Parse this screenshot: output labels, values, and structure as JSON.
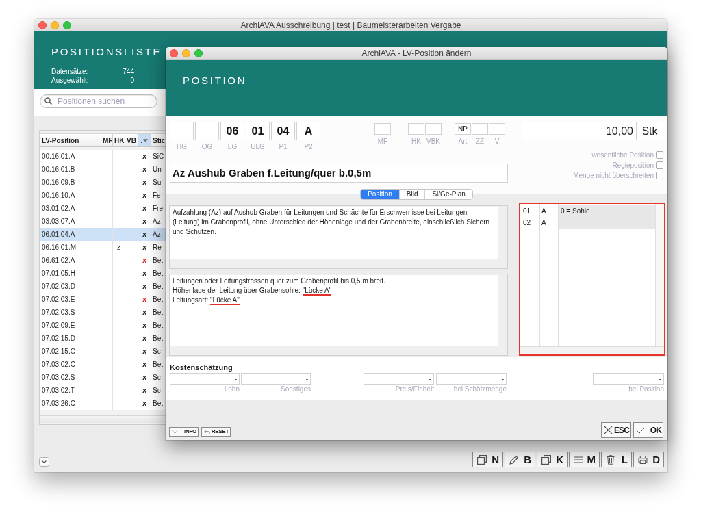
{
  "back_window": {
    "title": "ArchiAVA Ausschreibung | test | Baumeisterarbeiten Vergabe",
    "heading": "POSITIONSLISTE",
    "stats": [
      {
        "label": "Datensätze:",
        "value": "744"
      },
      {
        "label": "Ausgewählt:",
        "value": "0"
      }
    ],
    "search": {
      "placeholder": "Positionen suchen"
    },
    "table": {
      "columns": [
        {
          "label": "LV-Position",
          "sorted": false
        },
        {
          "label": "MF",
          "sorted": false
        },
        {
          "label": "HK",
          "sorted": false
        },
        {
          "label": "VB",
          "sorted": false
        },
        {
          "label": ".",
          "sorted": true
        },
        {
          "label": "Stic",
          "sorted": false
        }
      ],
      "rows": [
        {
          "position": "00.16.01.A",
          "column_5": "x",
          "color": "#1e1e1e",
          "column_6": "SiC",
          "selected": false
        },
        {
          "position": "00.16.01.B",
          "column_5": "x",
          "color": "#1e1e1e",
          "column_6": "Un",
          "selected": false
        },
        {
          "position": "00.16.09.B",
          "column_5": "x",
          "color": "#1e1e1e",
          "column_6": "Su",
          "selected": false
        },
        {
          "position": "00.16.10.A",
          "column_5": "x",
          "color": "#1e1e1e",
          "column_6": "Fe",
          "selected": false
        },
        {
          "position": "03.01.02.A",
          "column_5": "x",
          "color": "#1e1e1e",
          "column_6": "Fre",
          "selected": false
        },
        {
          "position": "03.03.07.A",
          "column_5": "x",
          "color": "#1e1e1e",
          "column_6": "Az",
          "selected": false
        },
        {
          "position": "06.01.04.A",
          "column_5": "x",
          "color": "#1e1e1e",
          "column_6": "Az",
          "selected": true
        },
        {
          "position": "06.16.01.M",
          "hk": "z",
          "column_5": "x",
          "color": "#1e1e1e",
          "column_6": "Re",
          "selected": false
        },
        {
          "position": "06.61.02.A",
          "column_5": "x",
          "color": "#e02424",
          "column_6": "Bet",
          "selected": false
        },
        {
          "position": "07.01.05.H",
          "column_5": "x",
          "color": "#1e1e1e",
          "column_6": "Bet",
          "selected": false
        },
        {
          "position": "07.02.03.D",
          "column_5": "x",
          "color": "#1e1e1e",
          "column_6": "Bet",
          "selected": false
        },
        {
          "position": "07.02.03.E",
          "column_5": "x",
          "color": "#e02424",
          "column_6": "Bet",
          "selected": false
        },
        {
          "position": "07.02.03.S",
          "column_5": "x",
          "color": "#1e1e1e",
          "column_6": "Bet",
          "selected": false
        },
        {
          "position": "07.02.09.E",
          "column_5": "x",
          "color": "#1e1e1e",
          "column_6": "Bet",
          "selected": false
        },
        {
          "position": "07.02.15.D",
          "column_5": "x",
          "color": "#1e1e1e",
          "column_6": "Bet",
          "selected": false
        },
        {
          "position": "07.02.15.O",
          "column_5": "x",
          "color": "#1e1e1e",
          "column_6": "Sc",
          "selected": false
        },
        {
          "position": "07.03.02.C",
          "column_5": "x",
          "color": "#1e1e1e",
          "column_6": "Bet",
          "selected": false
        },
        {
          "position": "07.03.02.S",
          "column_5": "x",
          "color": "#1e1e1e",
          "column_6": "Sc",
          "selected": false
        },
        {
          "position": "07.03.02.T",
          "column_5": "x",
          "color": "#1e1e1e",
          "column_6": "Sc",
          "selected": false
        },
        {
          "position": "07.03.26.C",
          "column_5": "x",
          "color": "#1e1e1e",
          "column_6": "Bet",
          "selected": false
        }
      ]
    },
    "toolbar": [
      {
        "kind": "new",
        "label": "N"
      },
      {
        "kind": "edit",
        "label": "B"
      },
      {
        "kind": "copy",
        "label": "K"
      },
      {
        "kind": "list",
        "label": "M"
      },
      {
        "kind": "delete",
        "label": "L"
      },
      {
        "kind": "print",
        "label": "D"
      }
    ]
  },
  "dialog": {
    "title": "ArchiAVA - LV-Position ändern",
    "heading": "POSITION",
    "code_fields": [
      {
        "label": "HG"
      },
      {
        "label": "OG"
      },
      {
        "label": "LG",
        "value": "06"
      },
      {
        "label": "ULG",
        "value": "01"
      },
      {
        "label": "P1",
        "value": "04"
      },
      {
        "label": "P2",
        "value": "A"
      }
    ],
    "flag_groups": [
      {
        "fields": [
          {
            "label": "MF"
          }
        ]
      },
      {
        "fields": [
          {
            "label": "HK"
          },
          {
            "label": "VBK"
          }
        ]
      },
      {
        "fields": [
          {
            "label": "Art",
            "value": "NP"
          },
          {
            "label": "ZZ"
          },
          {
            "label": "V"
          }
        ]
      }
    ],
    "quantity": {
      "value": "10,00",
      "unit": "Stk"
    },
    "options": [
      {
        "label": "wesentliche Position",
        "checked": false
      },
      {
        "label": "Regieposition",
        "checked": false
      },
      {
        "label": "Menge nicht überschreiten",
        "checked": false
      }
    ],
    "short_text": "Az Aushub Graben f.Leitung/quer b.0,5m",
    "tabs": [
      {
        "label": "Position",
        "selected": true
      },
      {
        "label": "Bild",
        "selected": false
      },
      {
        "label": "Si/Ge-Plan",
        "selected": false
      }
    ],
    "long_text": "Aufzahlung (Az) auf Aushub Graben für Leitungen und Schächte für Erschwernisse bei Leitungen (Leitung) im Grabenprofil, ohne Unterschied der Höhenlage und der Grabenbreite, einschließlich Sichern und Schützen.",
    "supplement_lines": [
      {
        "text": "Leitungen oder Leitungstrassen quer zum Grabenprofil bis 0,5 m breit."
      },
      {
        "text": "Höhenlage der Leitung über Grabensohle:",
        "blank": "\"Lücke A\""
      },
      {
        "text": "Leitungsart:",
        "blank": "\"Lücke A\""
      }
    ],
    "gap_table": {
      "highlighted": true,
      "rows": [
        {
          "column_1": "01",
          "column_2": "A",
          "column_3": "0 = Sohle"
        },
        {
          "column_1": "02",
          "column_2": "A"
        }
      ]
    },
    "cost_estimate": {
      "title": "Kostenschätzung",
      "groups": [
        {
          "fields": [
            {
              "label": "Lohn",
              "value": "-"
            },
            {
              "label": "Sonstiges",
              "value": "-"
            }
          ]
        },
        {
          "fields": [
            {
              "label": "Preis/Einheit",
              "value": "-"
            },
            {
              "label": "bei Schätzmenge",
              "value": "-"
            }
          ]
        },
        {
          "fields": [
            {
              "label": "bei Position",
              "value": "-"
            }
          ]
        }
      ]
    },
    "footer_buttons": [
      {
        "kind": "info",
        "label": "INFO"
      },
      {
        "kind": "reset",
        "label": "RESET"
      }
    ],
    "action_buttons": [
      {
        "kind": "cancel",
        "label": "ESC"
      },
      {
        "kind": "confirm",
        "label": "OK"
      }
    ]
  }
}
